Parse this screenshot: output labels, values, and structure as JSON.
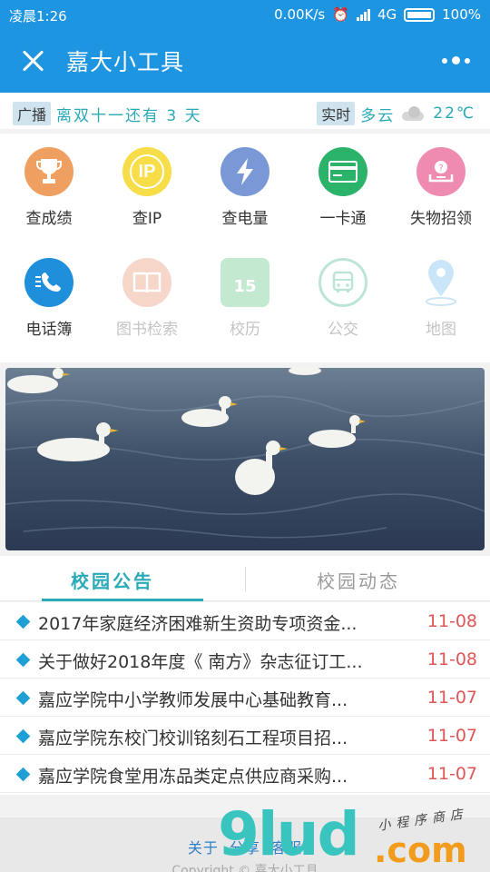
{
  "status_bar": {
    "time": "凌晨1:26",
    "net_speed": "0.00K/s",
    "network": "4G",
    "battery": "100%"
  },
  "app_bar": {
    "title": "嘉大小工具"
  },
  "ticker": {
    "broadcast_tag": "广播",
    "broadcast_text": "离双十一还有 3 天",
    "weather_tag": "实时",
    "weather_text": "多云",
    "temperature": "22℃"
  },
  "grid": [
    {
      "label": "查成绩",
      "icon": "trophy-icon",
      "color": "#ef9f60",
      "enabled": true
    },
    {
      "label": "查IP",
      "icon": "ip-icon",
      "color": "#f7dd48",
      "enabled": true
    },
    {
      "label": "查电量",
      "icon": "lightning-icon",
      "color": "#7a97d6",
      "enabled": true
    },
    {
      "label": "一卡通",
      "icon": "card-icon",
      "color": "#2cb36a",
      "enabled": true
    },
    {
      "label": "失物招领",
      "icon": "lost-found-icon",
      "color": "#ef8bb0",
      "enabled": true
    },
    {
      "label": "电话簿",
      "icon": "phone-icon",
      "color": "#1f8fdc",
      "enabled": true
    },
    {
      "label": "图书检索",
      "icon": "book-icon",
      "color": "#e9a58a",
      "enabled": false
    },
    {
      "label": "校历",
      "icon": "calendar-icon",
      "color": "#7ccf9a",
      "enabled": false
    },
    {
      "label": "公交",
      "icon": "bus-icon",
      "color": "#6dc6a3",
      "enabled": false
    },
    {
      "label": "地图",
      "icon": "map-pin-icon",
      "color": "#8cc6ee",
      "enabled": false
    }
  ],
  "calendar_day": "15",
  "ip_text": "IP",
  "tabs": [
    {
      "label": "校园公告",
      "active": true
    },
    {
      "label": "校园动态",
      "active": false
    }
  ],
  "notices": [
    {
      "title": "2017年家庭经济困难新生资助专项资金...",
      "date": "11-08"
    },
    {
      "title": "关于做好2018年度《 南方》杂志征订工...",
      "date": "11-08"
    },
    {
      "title": "嘉应学院中小学教师发展中心基础教育...",
      "date": "11-07"
    },
    {
      "title": "嘉应学院东校门校训铭刻石工程项目招...",
      "date": "11-07"
    },
    {
      "title": "嘉应学院食堂用冻品类定点供应商采购...",
      "date": "11-07"
    }
  ],
  "footer": {
    "about": "关于",
    "share": "分享",
    "service": "客服",
    "copyright": "Copyright © 嘉大小工具"
  },
  "watermark": {
    "main": "9lud",
    "suffix": ".com",
    "tagline": "小程序商店"
  }
}
